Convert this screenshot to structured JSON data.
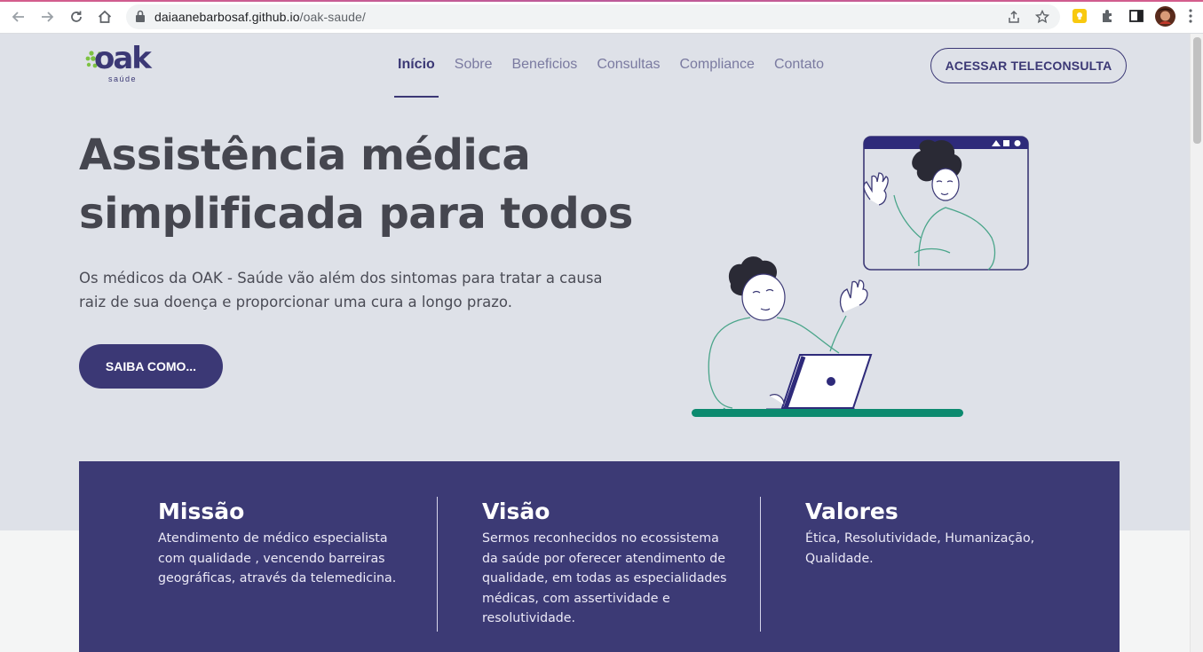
{
  "browser": {
    "url_host": "daiaanebarbosaf.github.io",
    "url_path": "/oak-saude/"
  },
  "header": {
    "logo_name": "oak",
    "logo_sub": "saúde",
    "nav": [
      {
        "label": "Início",
        "active": true
      },
      {
        "label": "Sobre",
        "active": false
      },
      {
        "label": "Beneficios",
        "active": false
      },
      {
        "label": "Consultas",
        "active": false
      },
      {
        "label": "Compliance",
        "active": false
      },
      {
        "label": "Contato",
        "active": false
      }
    ],
    "cta_label": "ACESSAR TELECONSULTA"
  },
  "hero": {
    "title_line1": "Assistência médica",
    "title_line2": "simplificada para todos",
    "text_line1": "Os médicos da OAK - Saúde vão além dos sintomas para tratar a causa",
    "text_line2": "raiz de sua doença e proporcionar uma cura a longo prazo.",
    "button_label": "SAIBA COMO..."
  },
  "mvv": [
    {
      "title": "Missão",
      "lines": [
        "Atendimento de médico especialista",
        "com qualidade , vencendo barreiras",
        "geográficas, através da telemedicina."
      ]
    },
    {
      "title": "Visão",
      "lines": [
        "Sermos reconhecidos no ecossistema",
        "da saúde por oferecer atendimento de",
        "qualidade, em todas as especialidades",
        "médicas, com assertividade e",
        "resolutividade."
      ]
    },
    {
      "title": "Valores",
      "lines": [
        "Ética, Resolutividade, Humanização,",
        "Qualidade."
      ]
    }
  ],
  "colors": {
    "brand_primary": "#3b3875",
    "brand_green": "#7dc242",
    "page_bg": "#dee1e8",
    "illustration_teal": "#0c8a6f"
  }
}
